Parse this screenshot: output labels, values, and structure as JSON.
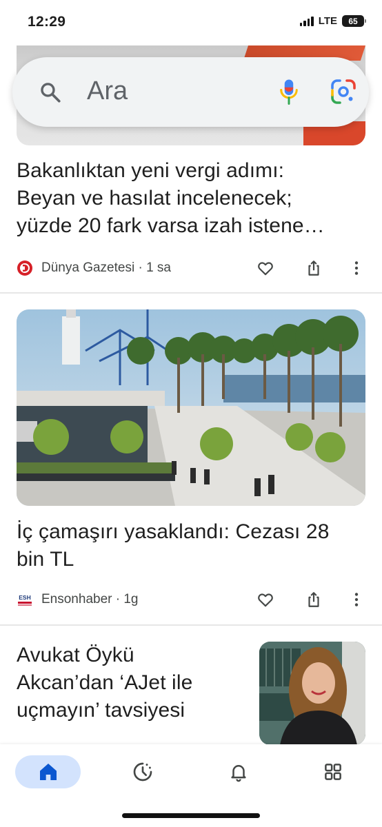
{
  "status_bar": {
    "time": "12:29",
    "network": "LTE",
    "battery": "65"
  },
  "search": {
    "placeholder": "Ara",
    "icons": [
      "search-icon",
      "microphone-icon",
      "google-lens-icon"
    ]
  },
  "articles": [
    {
      "headline_lines": [
        "Bakanlıktan yeni vergi adımı:",
        "Beyan ve hasılat incelenecek;",
        "yüzde 20 fark varsa izah istene…"
      ],
      "source": "Dünya Gazetesi",
      "time": "1 sa",
      "meta": "Dünya Gazetesi · 1 sa",
      "logo_color": "#d62027"
    },
    {
      "headline_lines": [
        "İç çamaşırı yasaklandı: Cezası 28",
        "bin TL"
      ],
      "source": "Ensonhaber",
      "time": "1g",
      "meta": "Ensonhaber · 1g",
      "logo_text": "ESH",
      "logo_color": "#c8102e"
    },
    {
      "headline_lines": [
        "Avukat Öykü",
        "Akcan’dan ‘AJet ile",
        "uçmayın’ tavsiyesi"
      ]
    }
  ],
  "article_actions": [
    "heart-icon",
    "share-icon",
    "more-vertical-icon"
  ],
  "bottom_nav": {
    "items": [
      "home-icon",
      "clock-icon",
      "bell-icon",
      "grid-icon"
    ],
    "active": "home-icon",
    "accent": "#0b57d0",
    "active_bg": "#d3e3fd"
  }
}
